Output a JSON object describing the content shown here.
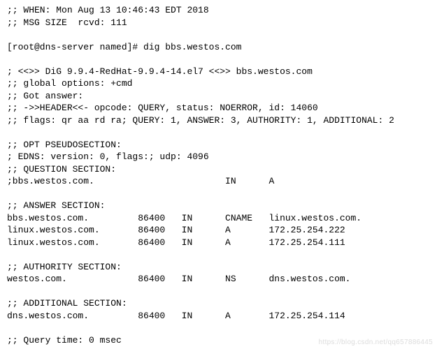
{
  "header": {
    "when": ";; WHEN: Mon Aug 13 10:46:43 EDT 2018",
    "msg_size": ";; MSG SIZE  rcvd: 111"
  },
  "prompt": "[root@dns-server named]# dig bbs.westos.com",
  "dig": {
    "banner": "; <<>> DiG 9.9.4-RedHat-9.9.4-14.el7 <<>> bbs.westos.com",
    "global_options": ";; global options: +cmd",
    "got_answer": ";; Got answer:",
    "header_line": ";; ->>HEADER<<- opcode: QUERY, status: NOERROR, id: 14060",
    "flags_line": ";; flags: qr aa rd ra; QUERY: 1, ANSWER: 3, AUTHORITY: 1, ADDITIONAL: 2"
  },
  "opt": {
    "title": ";; OPT PSEUDOSECTION:",
    "edns": "; EDNS: version: 0, flags:; udp: 4096"
  },
  "question": {
    "title": ";; QUESTION SECTION:",
    "row": ";bbs.westos.com.                        IN      A"
  },
  "answer": {
    "title": ";; ANSWER SECTION:",
    "rows": [
      "bbs.westos.com.         86400   IN      CNAME   linux.westos.com.",
      "linux.westos.com.       86400   IN      A       172.25.254.222",
      "linux.westos.com.       86400   IN      A       172.25.254.111"
    ]
  },
  "authority": {
    "title": ";; AUTHORITY SECTION:",
    "rows": [
      "westos.com.             86400   IN      NS      dns.westos.com."
    ]
  },
  "additional": {
    "title": ";; ADDITIONAL SECTION:",
    "rows": [
      "dns.westos.com.         86400   IN      A       172.25.254.114"
    ]
  },
  "footer": {
    "query_time": ";; Query time: 0 msec"
  },
  "watermark": "https://blog.csdn.net/qq657886445"
}
